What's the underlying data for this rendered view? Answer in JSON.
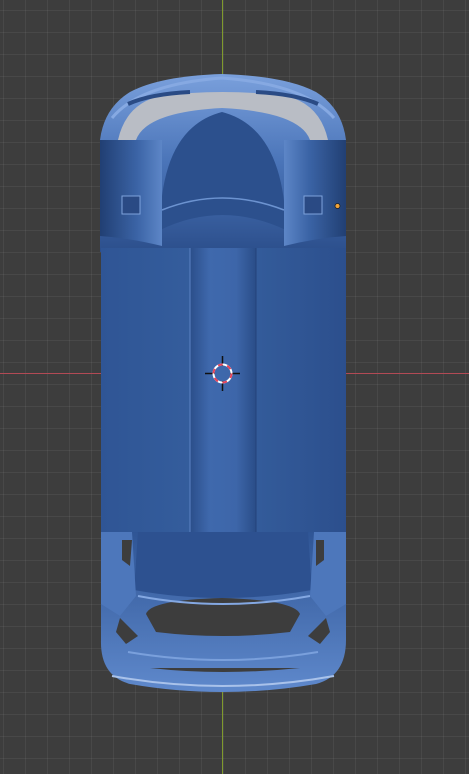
{
  "viewport": {
    "background_color": "#3d3d3d",
    "grid_color": "#4a4a4a",
    "x_axis_color": "#b24a55",
    "y_axis_color": "#7f9a2c"
  },
  "model": {
    "base_color": "#33599a",
    "highlight_color": "#6e95d2",
    "shadow_color": "#213e70",
    "inner_color": "#c9ccd2"
  },
  "origin_marker": {
    "color": "#f0a33a"
  },
  "cursor_3d": {
    "icon": "3d-cursor-icon",
    "ring_color_a": "#e7435a",
    "ring_color_b": "#ffffff"
  }
}
